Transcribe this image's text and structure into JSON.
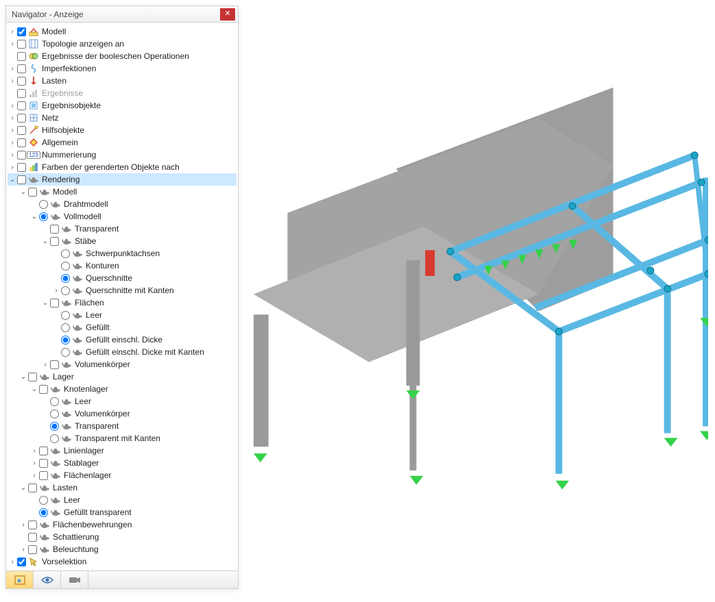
{
  "panel": {
    "title": "Navigator - Anzeige"
  },
  "tabs": {
    "data": "Daten",
    "views": "Ansichten",
    "cam": "Kamera"
  },
  "tree": [
    {
      "d": 0,
      "exp": ">",
      "ctl": "cb",
      "chk": true,
      "icon": "model",
      "label": "Modell"
    },
    {
      "d": 0,
      "exp": ">",
      "ctl": "cb",
      "chk": false,
      "icon": "topo",
      "label": "Topologie anzeigen an"
    },
    {
      "d": 0,
      "exp": "",
      "ctl": "cb",
      "chk": false,
      "icon": "bool",
      "label": "Ergebnisse der booleschen Operationen"
    },
    {
      "d": 0,
      "exp": ">",
      "ctl": "cb",
      "chk": false,
      "icon": "imperf",
      "label": "Imperfektionen"
    },
    {
      "d": 0,
      "exp": ">",
      "ctl": "cb",
      "chk": false,
      "icon": "loads",
      "label": "Lasten"
    },
    {
      "d": 0,
      "exp": "",
      "ctl": "cb",
      "chk": false,
      "icon": "results",
      "label": "Ergebnisse",
      "disabled": true
    },
    {
      "d": 0,
      "exp": ">",
      "ctl": "cb",
      "chk": false,
      "icon": "resobj",
      "label": "Ergebnisobjekte"
    },
    {
      "d": 0,
      "exp": ">",
      "ctl": "cb",
      "chk": false,
      "icon": "mesh",
      "label": "Netz"
    },
    {
      "d": 0,
      "exp": ">",
      "ctl": "cb",
      "chk": false,
      "icon": "aux",
      "label": "Hilfsobjekte"
    },
    {
      "d": 0,
      "exp": ">",
      "ctl": "cb",
      "chk": false,
      "icon": "general",
      "label": "Allgemein"
    },
    {
      "d": 0,
      "exp": ">",
      "ctl": "cb",
      "chk": false,
      "icon": "num",
      "label": "Nummerierung"
    },
    {
      "d": 0,
      "exp": ">",
      "ctl": "cb",
      "chk": false,
      "icon": "colors",
      "label": "Farben der gerenderten Objekte nach"
    },
    {
      "d": 0,
      "exp": "v",
      "ctl": "cb",
      "chk": false,
      "icon": "teapot",
      "label": "Rendering",
      "selected": true
    },
    {
      "d": 1,
      "exp": "v",
      "ctl": "cb",
      "chk": false,
      "icon": "teapot",
      "label": "Modell"
    },
    {
      "d": 2,
      "exp": "",
      "ctl": "rb",
      "chk": false,
      "icon": "teapot",
      "label": "Drahtmodell"
    },
    {
      "d": 2,
      "exp": "v",
      "ctl": "rb",
      "chk": true,
      "icon": "teapot",
      "label": "Vollmodell"
    },
    {
      "d": 3,
      "exp": "",
      "ctl": "cb",
      "chk": false,
      "icon": "teapot",
      "label": "Transparent"
    },
    {
      "d": 3,
      "exp": "v",
      "ctl": "cb",
      "chk": false,
      "icon": "teapot",
      "label": "Stäbe"
    },
    {
      "d": 4,
      "exp": "",
      "ctl": "rb",
      "chk": false,
      "icon": "teapot",
      "label": "Schwerpunktachsen"
    },
    {
      "d": 4,
      "exp": "",
      "ctl": "rb",
      "chk": false,
      "icon": "teapot",
      "label": "Konturen"
    },
    {
      "d": 4,
      "exp": "",
      "ctl": "rb",
      "chk": true,
      "icon": "teapot",
      "label": "Querschnitte"
    },
    {
      "d": 4,
      "exp": ">",
      "ctl": "rb",
      "chk": false,
      "icon": "teapot",
      "label": "Querschnitte mit Kanten"
    },
    {
      "d": 3,
      "exp": "v",
      "ctl": "cb",
      "chk": false,
      "icon": "teapot",
      "label": "Flächen"
    },
    {
      "d": 4,
      "exp": "",
      "ctl": "rb",
      "chk": false,
      "icon": "teapot",
      "label": "Leer"
    },
    {
      "d": 4,
      "exp": "",
      "ctl": "rb",
      "chk": false,
      "icon": "teapot",
      "label": "Gefüllt"
    },
    {
      "d": 4,
      "exp": "",
      "ctl": "rb",
      "chk": true,
      "icon": "teapot",
      "label": "Gefüllt einschl. Dicke"
    },
    {
      "d": 4,
      "exp": "",
      "ctl": "rb",
      "chk": false,
      "icon": "teapot",
      "label": "Gefüllt einschl. Dicke mit Kanten"
    },
    {
      "d": 3,
      "exp": ">",
      "ctl": "cb",
      "chk": false,
      "icon": "teapot",
      "label": "Volumenkörper"
    },
    {
      "d": 1,
      "exp": "v",
      "ctl": "cb",
      "chk": false,
      "icon": "teapot",
      "label": "Lager"
    },
    {
      "d": 2,
      "exp": "v",
      "ctl": "cb",
      "chk": false,
      "icon": "teapot",
      "label": "Knotenlager"
    },
    {
      "d": 3,
      "exp": "",
      "ctl": "rb",
      "chk": false,
      "icon": "teapot",
      "label": "Leer"
    },
    {
      "d": 3,
      "exp": "",
      "ctl": "rb",
      "chk": false,
      "icon": "teapot",
      "label": "Volumenkörper"
    },
    {
      "d": 3,
      "exp": "",
      "ctl": "rb",
      "chk": true,
      "icon": "teapot",
      "label": "Transparent"
    },
    {
      "d": 3,
      "exp": "",
      "ctl": "rb",
      "chk": false,
      "icon": "teapot",
      "label": "Transparent mit Kanten"
    },
    {
      "d": 2,
      "exp": ">",
      "ctl": "cb",
      "chk": false,
      "icon": "teapot",
      "label": "Linienlager"
    },
    {
      "d": 2,
      "exp": ">",
      "ctl": "cb",
      "chk": false,
      "icon": "teapot",
      "label": "Stablager"
    },
    {
      "d": 2,
      "exp": ">",
      "ctl": "cb",
      "chk": false,
      "icon": "teapot",
      "label": "Flächenlager"
    },
    {
      "d": 1,
      "exp": "v",
      "ctl": "cb",
      "chk": false,
      "icon": "teapot",
      "label": "Lasten"
    },
    {
      "d": 2,
      "exp": "",
      "ctl": "rb",
      "chk": false,
      "icon": "teapot",
      "label": "Leer"
    },
    {
      "d": 2,
      "exp": "",
      "ctl": "rb",
      "chk": true,
      "icon": "teapot",
      "label": "Gefüllt transparent"
    },
    {
      "d": 1,
      "exp": ">",
      "ctl": "cb",
      "chk": false,
      "icon": "teapot",
      "label": "Flächenbewehrungen"
    },
    {
      "d": 1,
      "exp": "",
      "ctl": "cb",
      "chk": false,
      "icon": "teapot",
      "label": "Schattierung"
    },
    {
      "d": 1,
      "exp": ">",
      "ctl": "cb",
      "chk": false,
      "icon": "teapot",
      "label": "Beleuchtung"
    },
    {
      "d": 0,
      "exp": ">",
      "ctl": "cb",
      "chk": true,
      "icon": "presel",
      "label": "Vorselektion"
    }
  ]
}
